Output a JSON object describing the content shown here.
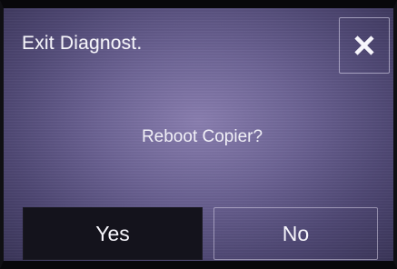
{
  "dialog": {
    "title": "Exit Diagnost.",
    "message": "Reboot Copier?",
    "close_icon": "close-icon",
    "buttons": {
      "yes_label": "Yes",
      "no_label": "No"
    }
  },
  "colors": {
    "background": "#6e6596",
    "text": "#f3f2f8",
    "yes_button_bg": "#14131c"
  }
}
